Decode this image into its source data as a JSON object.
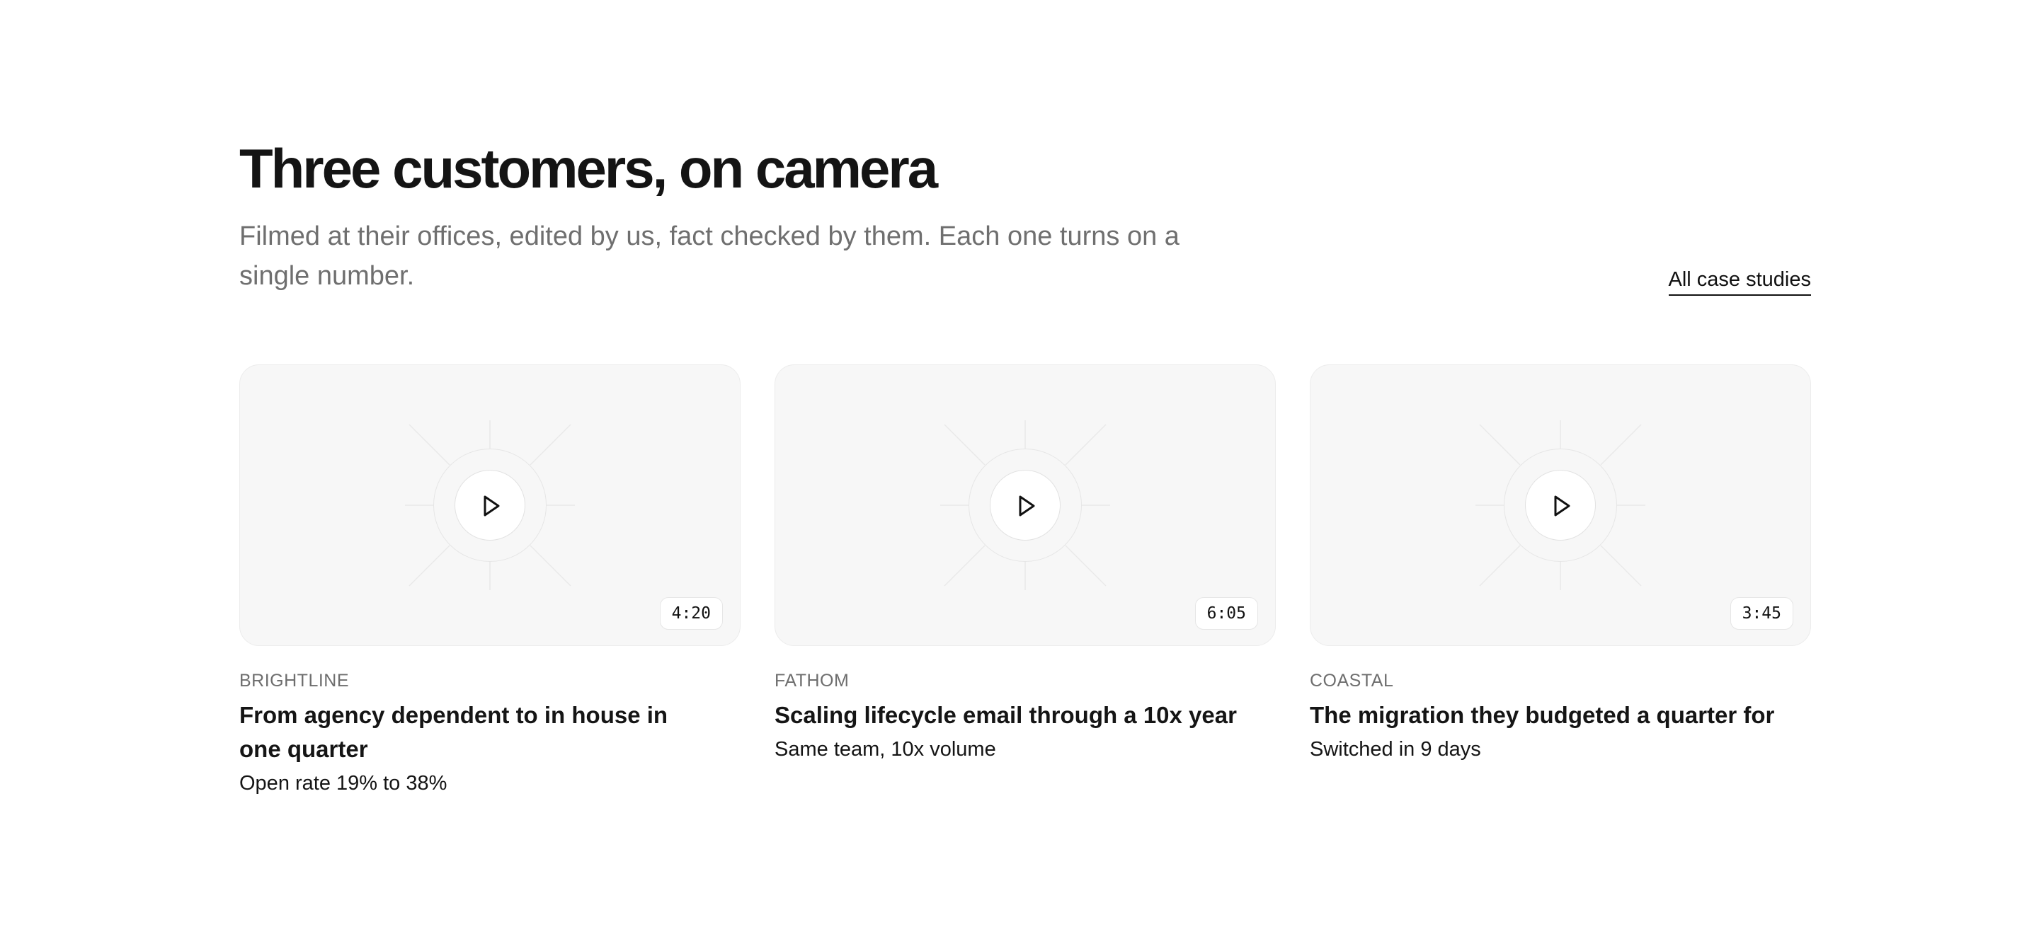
{
  "section": {
    "title": "Three customers, on camera",
    "subtitle": "Filmed at their offices, edited by us, fact checked by them. Each one turns on a single number.",
    "all_link": "All case studies"
  },
  "cards": [
    {
      "duration": "4:20",
      "company": "BRIGHTLINE",
      "title": "From agency dependent to in house in one quarter",
      "metric": "Open rate 19% to 38%",
      "icon": "play-icon"
    },
    {
      "duration": "6:05",
      "company": "FATHOM",
      "title": "Scaling lifecycle email through a 10x year",
      "metric": "Same team, 10x volume",
      "icon": "play-icon"
    },
    {
      "duration": "3:45",
      "company": "COASTAL",
      "title": "The migration they budgeted a quarter for",
      "metric": "Switched in 9 days",
      "icon": "play-icon"
    }
  ],
  "colors": {
    "background": "#ffffff",
    "thumbnail": "#f7f7f7",
    "text": "#111111",
    "muted": "#6f6f6f"
  }
}
